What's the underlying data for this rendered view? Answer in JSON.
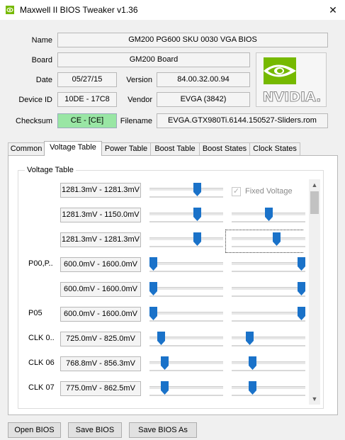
{
  "window": {
    "title": "Maxwell II BIOS Tweaker v1.36",
    "close_icon": "close-icon"
  },
  "info": {
    "name_label": "Name",
    "name_value": "GM200 PG600 SKU 0030 VGA BIOS",
    "board_label": "Board",
    "board_value": "GM200 Board",
    "date_label": "Date",
    "date_value": "05/27/15",
    "version_label": "Version",
    "version_value": "84.00.32.00.94",
    "device_label": "Device ID",
    "device_value": "10DE - 17C8",
    "vendor_label": "Vendor",
    "vendor_value": "EVGA (3842)",
    "checksum_label": "Checksum",
    "checksum_value": "CE - [CE]",
    "filename_label": "Filename",
    "filename_value": "EVGA.GTX980Ti.6144.150527-Sliders.rom",
    "logo_text": "NVIDIA."
  },
  "tabs": [
    "Common",
    "Voltage Table",
    "Power Table",
    "Boost Table",
    "Boost States",
    "Clock States"
  ],
  "voltage_table": {
    "title": "Voltage Table",
    "fixed_voltage_label": "Fixed Voltage",
    "rows": [
      {
        "label": "",
        "value": "1281.3mV - 1281.3mV",
        "slider1": 0.67,
        "slider2": null
      },
      {
        "label": "",
        "value": "1281.3mV - 1150.0mV",
        "slider1": 0.67,
        "slider2": 0.5
      },
      {
        "label": "",
        "value": "1281.3mV - 1281.3mV",
        "slider1": 0.67,
        "slider2": 0.62
      },
      {
        "label": "P00,P..",
        "value": "600.0mV - 1600.0mV",
        "slider1": 0.0,
        "slider2": 1.0
      },
      {
        "label": "",
        "value": "600.0mV - 1600.0mV",
        "slider1": 0.0,
        "slider2": 1.0
      },
      {
        "label": "P05",
        "value": "600.0mV - 1600.0mV",
        "slider1": 0.0,
        "slider2": 1.0
      },
      {
        "label": "CLK 0..",
        "value": "725.0mV - 825.0mV",
        "slider1": 0.12,
        "slider2": 0.22
      },
      {
        "label": "CLK 06",
        "value": "768.8mV - 856.3mV",
        "slider1": 0.17,
        "slider2": 0.26
      },
      {
        "label": "CLK 07",
        "value": "775.0mV - 862.5mV",
        "slider1": 0.17,
        "slider2": 0.26
      }
    ]
  },
  "buttons": {
    "open": "Open BIOS",
    "save": "Save BIOS",
    "save_as": "Save BIOS As"
  },
  "colors": {
    "accent_blue": "#1a72c9",
    "checksum_green": "#99e6a4",
    "nvidia_green": "#76b900"
  }
}
